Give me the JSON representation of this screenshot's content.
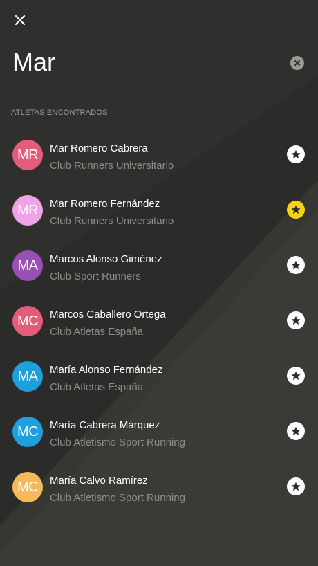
{
  "search": {
    "value": "Mar"
  },
  "section_label": "ATLETAS ENCONTRADOS",
  "athletes": [
    {
      "initials": "MR",
      "name": "Mar Romero Cabrera",
      "club": "Club Runners Universitario",
      "avatar_color": "#e35d7a",
      "favorite": false
    },
    {
      "initials": "MR",
      "name": "Mar Romero Fernández",
      "club": "Club Runners Universitario",
      "avatar_color": "#f2a3e8",
      "favorite": true
    },
    {
      "initials": "MA",
      "name": "Marcos Alonso Giménez",
      "club": "Club Sport Runners",
      "avatar_color": "#9a4fb3",
      "favorite": false
    },
    {
      "initials": "MC",
      "name": "Marcos Caballero Ortega",
      "club": "Club Atletas España",
      "avatar_color": "#e35d7a",
      "favorite": false
    },
    {
      "initials": "MA",
      "name": "María Alonso Fernández",
      "club": "Club Atletas España",
      "avatar_color": "#1ea0df",
      "favorite": false
    },
    {
      "initials": "MC",
      "name": "María Cabrera Márquez",
      "club": "Club Atletismo Sport Running",
      "avatar_color": "#1ea0df",
      "favorite": false
    },
    {
      "initials": "MC",
      "name": "María Calvo Ramírez",
      "club": "Club Atletismo Sport Running",
      "avatar_color": "#f5b95b",
      "favorite": false
    }
  ],
  "colors": {
    "background": "#2b2b29",
    "background_light": "#3a3a37",
    "favorite_active": "#f7d21c",
    "caret": "#1a8cff"
  },
  "icons": {
    "close": "close-icon",
    "clear": "clear-icon",
    "favorite": "star-icon"
  }
}
